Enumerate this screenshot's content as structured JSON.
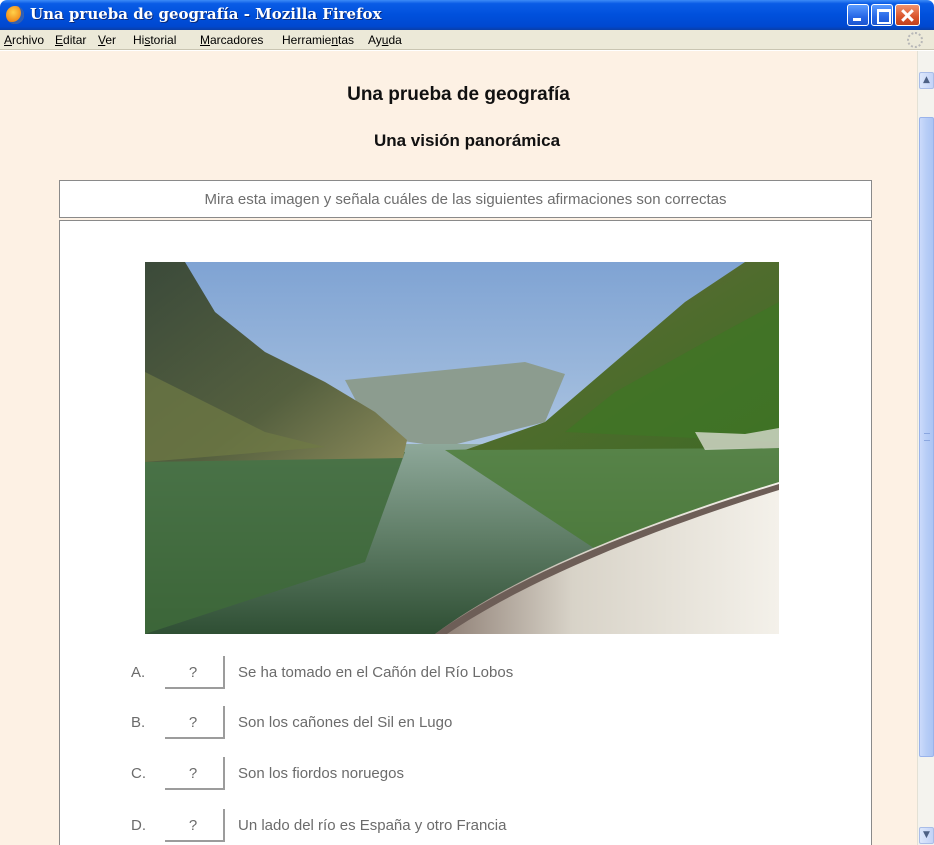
{
  "window": {
    "title": "Una prueba de geografía - Mozilla Firefox"
  },
  "menu": {
    "items": [
      {
        "label": "Archivo",
        "underline_index": 0
      },
      {
        "label": "Editar",
        "underline_index": 0
      },
      {
        "label": "Ver",
        "underline_index": 0
      },
      {
        "label": "Historial",
        "underline_index": 2
      },
      {
        "label": "Marcadores",
        "underline_index": 0
      },
      {
        "label": "Herramientas",
        "underline_index": 8
      },
      {
        "label": "Ayuda",
        "underline_index": 2
      }
    ]
  },
  "page": {
    "title": "Una prueba de geografía",
    "subtitle": "Una visión panorámica",
    "instruction": "Mira esta imagen y señala cuáles de las siguientes afirmaciones son correctas",
    "image": {
      "subject": "river-canyon-photo"
    },
    "options": [
      {
        "letter": "A.",
        "answer": "?",
        "text": "Se ha tomado en el Cañón del Río Lobos"
      },
      {
        "letter": "B.",
        "answer": "?",
        "text": "Son los cañones del Sil en Lugo"
      },
      {
        "letter": "C.",
        "answer": "?",
        "text": "Son los fiordos noruegos"
      },
      {
        "letter": "D.",
        "answer": "?",
        "text": "Un lado del río es España y otro Francia"
      }
    ]
  },
  "colors": {
    "page_background": "#fdf1e4",
    "titlebar_blue": "#0050dc",
    "text_gray": "#6b6b6b"
  }
}
